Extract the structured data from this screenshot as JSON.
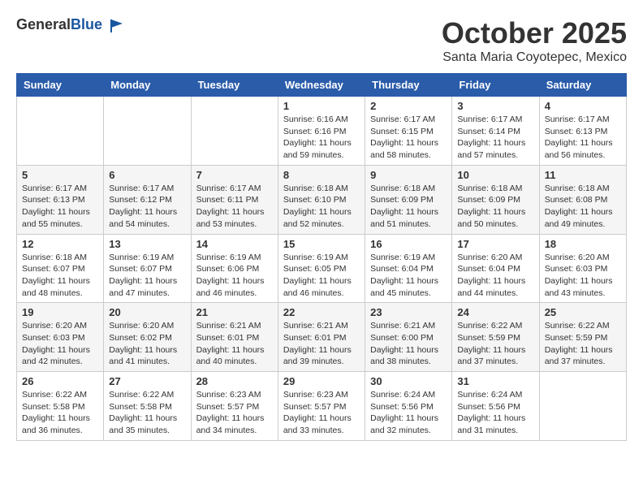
{
  "header": {
    "logo_general": "General",
    "logo_blue": "Blue",
    "month": "October 2025",
    "location": "Santa Maria Coyotepec, Mexico"
  },
  "weekdays": [
    "Sunday",
    "Monday",
    "Tuesday",
    "Wednesday",
    "Thursday",
    "Friday",
    "Saturday"
  ],
  "weeks": [
    [
      {
        "day": "",
        "info": ""
      },
      {
        "day": "",
        "info": ""
      },
      {
        "day": "",
        "info": ""
      },
      {
        "day": "1",
        "sunrise": "6:16 AM",
        "sunset": "6:16 PM",
        "daylight": "11 hours and 59 minutes."
      },
      {
        "day": "2",
        "sunrise": "6:17 AM",
        "sunset": "6:15 PM",
        "daylight": "11 hours and 58 minutes."
      },
      {
        "day": "3",
        "sunrise": "6:17 AM",
        "sunset": "6:14 PM",
        "daylight": "11 hours and 57 minutes."
      },
      {
        "day": "4",
        "sunrise": "6:17 AM",
        "sunset": "6:13 PM",
        "daylight": "11 hours and 56 minutes."
      }
    ],
    [
      {
        "day": "5",
        "sunrise": "6:17 AM",
        "sunset": "6:13 PM",
        "daylight": "11 hours and 55 minutes."
      },
      {
        "day": "6",
        "sunrise": "6:17 AM",
        "sunset": "6:12 PM",
        "daylight": "11 hours and 54 minutes."
      },
      {
        "day": "7",
        "sunrise": "6:17 AM",
        "sunset": "6:11 PM",
        "daylight": "11 hours and 53 minutes."
      },
      {
        "day": "8",
        "sunrise": "6:18 AM",
        "sunset": "6:10 PM",
        "daylight": "11 hours and 52 minutes."
      },
      {
        "day": "9",
        "sunrise": "6:18 AM",
        "sunset": "6:09 PM",
        "daylight": "11 hours and 51 minutes."
      },
      {
        "day": "10",
        "sunrise": "6:18 AM",
        "sunset": "6:09 PM",
        "daylight": "11 hours and 50 minutes."
      },
      {
        "day": "11",
        "sunrise": "6:18 AM",
        "sunset": "6:08 PM",
        "daylight": "11 hours and 49 minutes."
      }
    ],
    [
      {
        "day": "12",
        "sunrise": "6:18 AM",
        "sunset": "6:07 PM",
        "daylight": "11 hours and 48 minutes."
      },
      {
        "day": "13",
        "sunrise": "6:19 AM",
        "sunset": "6:07 PM",
        "daylight": "11 hours and 47 minutes."
      },
      {
        "day": "14",
        "sunrise": "6:19 AM",
        "sunset": "6:06 PM",
        "daylight": "11 hours and 46 minutes."
      },
      {
        "day": "15",
        "sunrise": "6:19 AM",
        "sunset": "6:05 PM",
        "daylight": "11 hours and 46 minutes."
      },
      {
        "day": "16",
        "sunrise": "6:19 AM",
        "sunset": "6:04 PM",
        "daylight": "11 hours and 45 minutes."
      },
      {
        "day": "17",
        "sunrise": "6:20 AM",
        "sunset": "6:04 PM",
        "daylight": "11 hours and 44 minutes."
      },
      {
        "day": "18",
        "sunrise": "6:20 AM",
        "sunset": "6:03 PM",
        "daylight": "11 hours and 43 minutes."
      }
    ],
    [
      {
        "day": "19",
        "sunrise": "6:20 AM",
        "sunset": "6:03 PM",
        "daylight": "11 hours and 42 minutes."
      },
      {
        "day": "20",
        "sunrise": "6:20 AM",
        "sunset": "6:02 PM",
        "daylight": "11 hours and 41 minutes."
      },
      {
        "day": "21",
        "sunrise": "6:21 AM",
        "sunset": "6:01 PM",
        "daylight": "11 hours and 40 minutes."
      },
      {
        "day": "22",
        "sunrise": "6:21 AM",
        "sunset": "6:01 PM",
        "daylight": "11 hours and 39 minutes."
      },
      {
        "day": "23",
        "sunrise": "6:21 AM",
        "sunset": "6:00 PM",
        "daylight": "11 hours and 38 minutes."
      },
      {
        "day": "24",
        "sunrise": "6:22 AM",
        "sunset": "5:59 PM",
        "daylight": "11 hours and 37 minutes."
      },
      {
        "day": "25",
        "sunrise": "6:22 AM",
        "sunset": "5:59 PM",
        "daylight": "11 hours and 37 minutes."
      }
    ],
    [
      {
        "day": "26",
        "sunrise": "6:22 AM",
        "sunset": "5:58 PM",
        "daylight": "11 hours and 36 minutes."
      },
      {
        "day": "27",
        "sunrise": "6:22 AM",
        "sunset": "5:58 PM",
        "daylight": "11 hours and 35 minutes."
      },
      {
        "day": "28",
        "sunrise": "6:23 AM",
        "sunset": "5:57 PM",
        "daylight": "11 hours and 34 minutes."
      },
      {
        "day": "29",
        "sunrise": "6:23 AM",
        "sunset": "5:57 PM",
        "daylight": "11 hours and 33 minutes."
      },
      {
        "day": "30",
        "sunrise": "6:24 AM",
        "sunset": "5:56 PM",
        "daylight": "11 hours and 32 minutes."
      },
      {
        "day": "31",
        "sunrise": "6:24 AM",
        "sunset": "5:56 PM",
        "daylight": "11 hours and 31 minutes."
      },
      {
        "day": "",
        "info": ""
      }
    ]
  ],
  "labels": {
    "sunrise": "Sunrise:",
    "sunset": "Sunset:",
    "daylight": "Daylight:"
  }
}
